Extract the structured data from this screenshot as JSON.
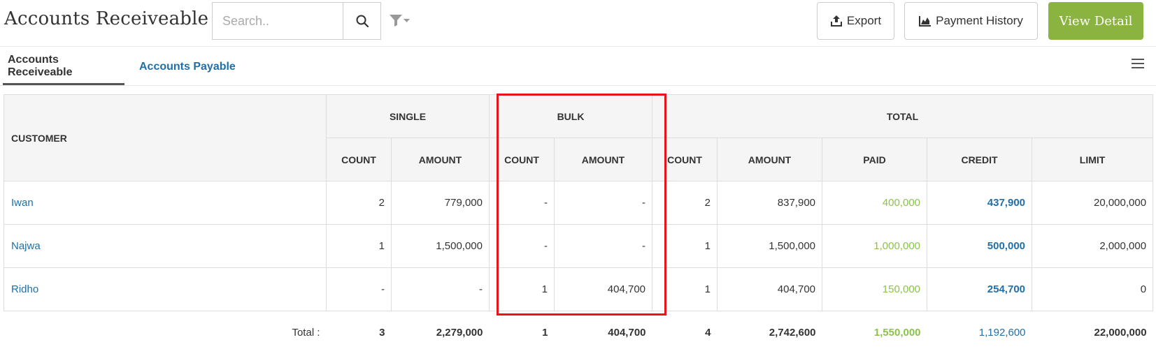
{
  "header": {
    "title": "Accounts Receiveable",
    "search_placeholder": "Search..",
    "export_label": "Export",
    "payment_history_label": "Payment History",
    "view_detail_label": "View Detail"
  },
  "tabs": [
    {
      "label": "Accounts Receiveable",
      "active": true
    },
    {
      "label": "Accounts Payable",
      "active": false
    }
  ],
  "table": {
    "headers": {
      "customer": "CUSTOMER",
      "single": "SINGLE",
      "bulk": "BULK",
      "total": "TOTAL",
      "sub": [
        "COUNT",
        "AMOUNT",
        "COUNT",
        "AMOUNT",
        "COUNT",
        "AMOUNT",
        "PAID",
        "CREDIT",
        "LIMIT"
      ]
    },
    "rows": [
      {
        "customer": "Iwan",
        "single_count": "2",
        "single_amount": "779,000",
        "bulk_count": "-",
        "bulk_amount": "-",
        "total_count": "2",
        "total_amount": "837,900",
        "paid": "400,000",
        "credit": "437,900",
        "limit": "20,000,000"
      },
      {
        "customer": "Najwa",
        "single_count": "1",
        "single_amount": "1,500,000",
        "bulk_count": "-",
        "bulk_amount": "-",
        "total_count": "1",
        "total_amount": "1,500,000",
        "paid": "1,000,000",
        "credit": "500,000",
        "limit": "2,000,000"
      },
      {
        "customer": "Ridho",
        "single_count": "-",
        "single_amount": "-",
        "bulk_count": "1",
        "bulk_amount": "404,700",
        "total_count": "1",
        "total_amount": "404,700",
        "paid": "150,000",
        "credit": "254,700",
        "limit": "0"
      }
    ],
    "totals": {
      "label": "Total :",
      "single_count": "3",
      "single_amount": "2,279,000",
      "bulk_count": "1",
      "bulk_amount": "404,700",
      "total_count": "4",
      "total_amount": "2,742,600",
      "paid": "1,550,000",
      "credit": "1,192,600",
      "limit": "22,000,000"
    }
  },
  "colors": {
    "accent_green": "#8bb33f",
    "link_blue": "#1f6fa8",
    "paid_green": "#8bc34a",
    "highlight_red": "#e8141c"
  }
}
